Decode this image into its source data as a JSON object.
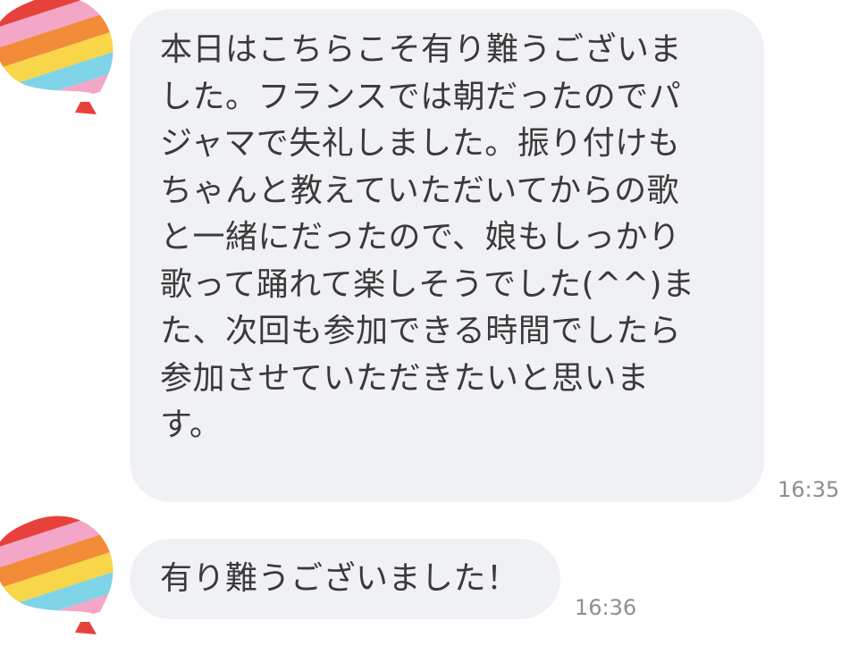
{
  "messages": [
    {
      "text": "本日はこちらこそ有り難うございま\nした。フランスでは朝だったのでパ\nジャマで失礼しました。振り付けも\nちゃんと教えていただいてからの歌\nと一緒にだったので、娘もしっかり\n歌って踊れて楽しそうでした(^^)ま\nた、次回も参加できる時間でしたら\n参加させていただきたいと思いま\nす。",
      "time": "16:35",
      "avatar_icon": "rainbow-balloon-icon"
    },
    {
      "text": "有り難うございました！",
      "time": "16:36",
      "avatar_icon": "rainbow-balloon-icon"
    }
  ],
  "colors": {
    "bubble_background": "#f0f1f4",
    "message_text": "#3a3a3a",
    "timestamp_text": "#8e8e93",
    "balloon_stripes": [
      "#e8413c",
      "#f28c38",
      "#f7d64a",
      "#7fd3e6",
      "#f3a6c8",
      "#c9e86b"
    ]
  }
}
